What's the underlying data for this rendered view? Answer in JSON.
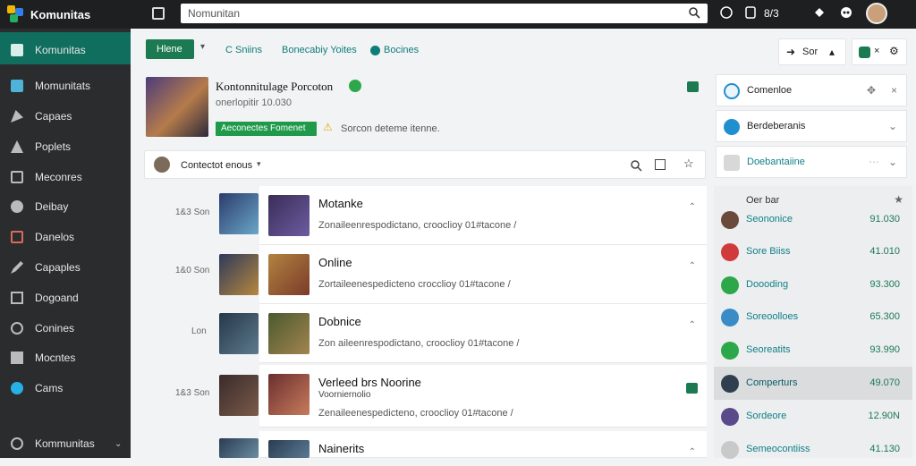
{
  "topbar": {
    "app_name": "Komunitas",
    "search_placeholder": "Nomunitan",
    "counter": "8/3"
  },
  "sidebar": {
    "items": [
      {
        "label": "Komunitas",
        "icon": "community-icon"
      },
      {
        "label": "Momunitats",
        "icon": "community-list-icon"
      },
      {
        "label": "Capaes",
        "icon": "brush-icon"
      },
      {
        "label": "Poplets",
        "icon": "rocket-icon"
      },
      {
        "label": "Meconres",
        "icon": "monitor-icon"
      },
      {
        "label": "Deibay",
        "icon": "gear-icon"
      },
      {
        "label": "Danelos",
        "icon": "tv-icon"
      },
      {
        "label": "Capaples",
        "icon": "pencil-icon"
      },
      {
        "label": "Dogoand",
        "icon": "message-icon"
      },
      {
        "label": "Conines",
        "icon": "chat-icon"
      },
      {
        "label": "Mocntes",
        "icon": "mail-icon"
      },
      {
        "label": "Cams",
        "icon": "compass-icon"
      }
    ],
    "footer": "Kommunitas"
  },
  "toolbar": {
    "home_button": "Hlene",
    "tabs": [
      "C Sniins",
      "Bonecabiy Yoites",
      "Bocines"
    ],
    "right_btn1": "Sor",
    "colors": {
      "accent": "#1b7a52",
      "teal": "#0e7d7a"
    }
  },
  "profile": {
    "title": "Kontonnitulage Porcoton",
    "subtitle": "onerlopitir 10.030",
    "badge": "Aeconectes Fomenet",
    "note": "Sorcon deteme itenne."
  },
  "filter": {
    "label": "Contectot enous"
  },
  "rows": [
    {
      "time": "1&3 Son",
      "title": "Motanke",
      "desc": "Zonaileenrespodictano, crooclioy 01#tacone /"
    },
    {
      "time": "1&0 Son",
      "title": "Online",
      "desc": "Zortaileenespedicteno crocclioy 01#tacone /"
    },
    {
      "time": "Lon",
      "title": "Dobnice",
      "desc": "Zon aileenrespodictano, crooclioy 01#tacone /"
    },
    {
      "time": "1&3 Son",
      "title": "Verleed brs Noorine",
      "subtitle": "Voorniernolio",
      "desc": "Zenaileenespedicteno, crooclioy 01#tacone /"
    },
    {
      "time": "",
      "title": "Nainerits",
      "desc": ""
    }
  ],
  "right": {
    "cards": [
      "Comenloe",
      "Berdeberanis",
      "Doebantaiine"
    ],
    "leaderboard_title": "Oer bar",
    "leaders": [
      {
        "name": "Seononice",
        "value": "91.030"
      },
      {
        "name": "Sore Biiss",
        "value": "41.010"
      },
      {
        "name": "Doooding",
        "value": "93.300"
      },
      {
        "name": "Soreoolloes",
        "value": "65.300"
      },
      {
        "name": "Seoreatits",
        "value": "93.990"
      },
      {
        "name": "Comperturs",
        "value": "49.070"
      },
      {
        "name": "Sordeore",
        "value": "12.90N"
      },
      {
        "name": "Semeocontiiss",
        "value": "41.130"
      }
    ]
  }
}
